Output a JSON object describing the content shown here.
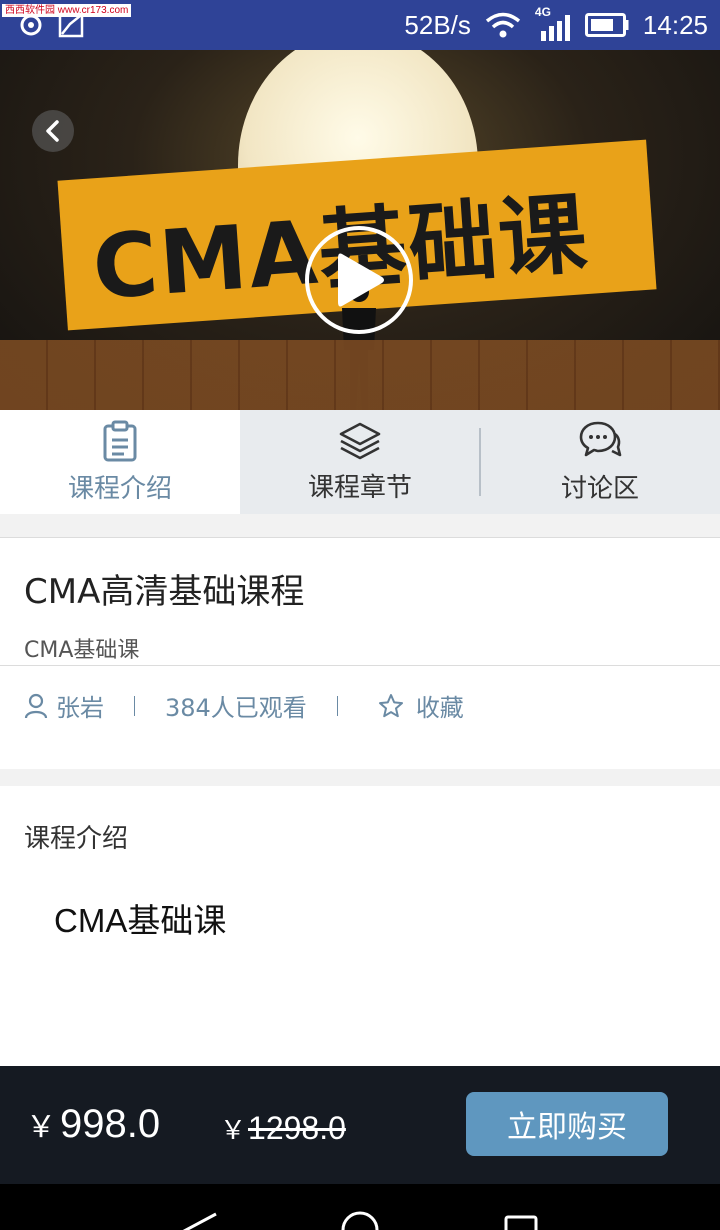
{
  "status_bar": {
    "watermark": "西西软件园 www.cr173.com",
    "speed": "52B/s",
    "network": "4G",
    "time": "14:25"
  },
  "hero": {
    "banner_text": "CMA基础课",
    "icons": {
      "back": "back-arrow-icon",
      "play": "play-icon"
    }
  },
  "tabs": [
    {
      "label": "课程介绍",
      "icon": "clipboard-icon",
      "active": true
    },
    {
      "label": "课程章节",
      "icon": "layers-icon",
      "active": false
    },
    {
      "label": "讨论区",
      "icon": "chat-bubbles-icon",
      "active": false
    }
  ],
  "course": {
    "title": "CMA高清基础课程",
    "subtitle": "CMA基础课",
    "teacher": "张岩",
    "views": "384人已观看",
    "favorite_label": "收藏"
  },
  "intro": {
    "heading": "课程介绍",
    "body": "CMA基础课"
  },
  "purchase": {
    "currency": "￥",
    "price": "998.0",
    "original_price": "1298.0",
    "buy_label": "立即购买"
  },
  "colors": {
    "status_bar": "#2f4397",
    "accent": "#6a8aa4",
    "buy_button": "#5f97bf",
    "buy_bar": "#151a22"
  }
}
